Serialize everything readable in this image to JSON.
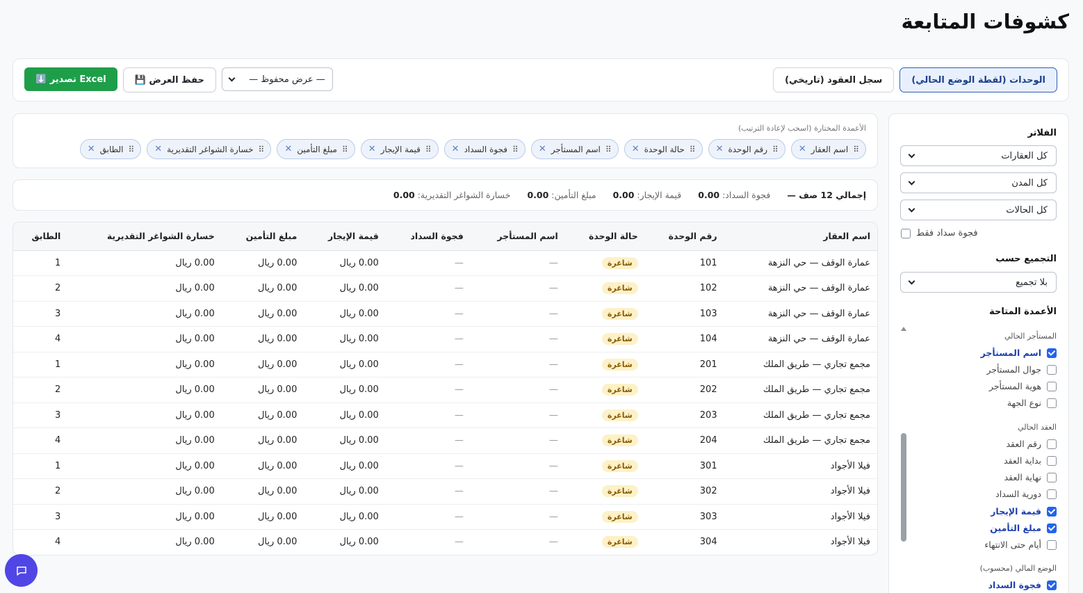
{
  "page": {
    "title": "كشوفات المتابعة"
  },
  "toolbar": {
    "tabs": [
      {
        "label": "الوحدات (لقطة الوضع الحالي)",
        "active": true
      },
      {
        "label": "سجل العقود (تاريخي)",
        "active": false
      }
    ],
    "saved_view_select": "— عرض محفوظ —",
    "save_view_label": "💾 حفظ العرض",
    "export_label": "⬇️ تصدير Excel"
  },
  "sidebar": {
    "filters_title": "الفلاتر",
    "property_filter": "كل العقارات",
    "city_filter": "كل المدن",
    "status_filter": "كل الحالات",
    "payment_gap_only_label": "فجوة سداد فقط",
    "group_by_title": "التجميع حسب",
    "group_by_value": "بلا تجميع",
    "available_columns_title": "الأعمدة المتاحة",
    "column_groups": [
      {
        "title": "المستأجر الحالي",
        "columns": [
          {
            "label": "اسم المستأجر",
            "checked": true
          },
          {
            "label": "جوال المستأجر",
            "checked": false
          },
          {
            "label": "هوية المستأجر",
            "checked": false
          },
          {
            "label": "نوع الجهة",
            "checked": false
          }
        ]
      },
      {
        "title": "العقد الحالي",
        "columns": [
          {
            "label": "رقم العقد",
            "checked": false
          },
          {
            "label": "بداية العقد",
            "checked": false
          },
          {
            "label": "نهاية العقد",
            "checked": false
          },
          {
            "label": "دورية السداد",
            "checked": false
          },
          {
            "label": "قيمة الإيجار",
            "checked": true
          },
          {
            "label": "مبلغ التأمين",
            "checked": true
          },
          {
            "label": "أيام حتى الانتهاء",
            "checked": false
          }
        ]
      },
      {
        "title": "الوضع المالي (محسوب)",
        "columns": [
          {
            "label": "فجوة السداد",
            "checked": true
          }
        ]
      }
    ]
  },
  "selected_columns": {
    "hint": "الأعمدة المختارة (اسحب لإعادة الترتيب)",
    "chips": [
      "اسم العقار",
      "رقم الوحدة",
      "حالة الوحدة",
      "اسم المستأجر",
      "فجوة السداد",
      "قيمة الإيجار",
      "مبلغ التأمين",
      "خسارة الشواغر التقديرية",
      "الطابق"
    ]
  },
  "summary": {
    "total": "إجمالي 12 صف —",
    "items": [
      {
        "label": "فجوة السداد:",
        "value": "0.00"
      },
      {
        "label": "قيمة الإيجار:",
        "value": "0.00"
      },
      {
        "label": "مبلغ التأمين:",
        "value": "0.00"
      },
      {
        "label": "خسارة الشواغر التقديرية:",
        "value": "0.00"
      }
    ]
  },
  "table": {
    "headers": [
      "اسم العقار",
      "رقم الوحدة",
      "حالة الوحدة",
      "اسم المستأجر",
      "فجوة السداد",
      "قيمة الإيجار",
      "مبلغ التأمين",
      "خسارة الشواغر التقديرية",
      "الطابق"
    ],
    "rows": [
      [
        "عمارة الوقف — حي النزهة",
        "101",
        "شاغرة",
        "—",
        "—",
        "0.00 ريال",
        "0.00 ريال",
        "0.00 ريال",
        "1"
      ],
      [
        "عمارة الوقف — حي النزهة",
        "102",
        "شاغرة",
        "—",
        "—",
        "0.00 ريال",
        "0.00 ريال",
        "0.00 ريال",
        "2"
      ],
      [
        "عمارة الوقف — حي النزهة",
        "103",
        "شاغرة",
        "—",
        "—",
        "0.00 ريال",
        "0.00 ريال",
        "0.00 ريال",
        "3"
      ],
      [
        "عمارة الوقف — حي النزهة",
        "104",
        "شاغرة",
        "—",
        "—",
        "0.00 ريال",
        "0.00 ريال",
        "0.00 ريال",
        "4"
      ],
      [
        "مجمع تجاري — طريق الملك",
        "201",
        "شاغرة",
        "—",
        "—",
        "0.00 ريال",
        "0.00 ريال",
        "0.00 ريال",
        "1"
      ],
      [
        "مجمع تجاري — طريق الملك",
        "202",
        "شاغرة",
        "—",
        "—",
        "0.00 ريال",
        "0.00 ريال",
        "0.00 ريال",
        "2"
      ],
      [
        "مجمع تجاري — طريق الملك",
        "203",
        "شاغرة",
        "—",
        "—",
        "0.00 ريال",
        "0.00 ريال",
        "0.00 ريال",
        "3"
      ],
      [
        "مجمع تجاري — طريق الملك",
        "204",
        "شاغرة",
        "—",
        "—",
        "0.00 ريال",
        "0.00 ريال",
        "0.00 ريال",
        "4"
      ],
      [
        "فيلا الأجواد",
        "301",
        "شاغرة",
        "—",
        "—",
        "0.00 ريال",
        "0.00 ريال",
        "0.00 ريال",
        "1"
      ],
      [
        "فيلا الأجواد",
        "302",
        "شاغرة",
        "—",
        "—",
        "0.00 ريال",
        "0.00 ريال",
        "0.00 ريال",
        "2"
      ],
      [
        "فيلا الأجواد",
        "303",
        "شاغرة",
        "—",
        "—",
        "0.00 ريال",
        "0.00 ريال",
        "0.00 ريال",
        "3"
      ],
      [
        "فيلا الأجواد",
        "304",
        "شاغرة",
        "—",
        "—",
        "0.00 ريال",
        "0.00 ريال",
        "0.00 ريال",
        "4"
      ]
    ]
  },
  "colors": {
    "accent": "#2563eb",
    "excel": "#1e9e49",
    "vacant_badge_bg": "#fdf1c7",
    "chat_fab": "#4f46e5"
  },
  "icons": {
    "chat": "chat-bubble-icon",
    "drag": "drag-handle-icon",
    "remove": "close-icon"
  }
}
